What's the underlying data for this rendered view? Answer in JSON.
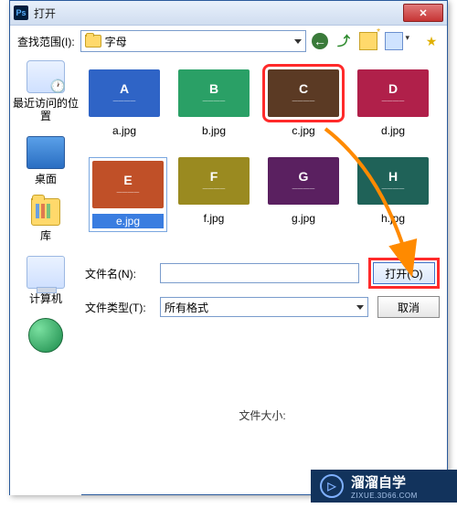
{
  "window": {
    "title": "打开"
  },
  "lookIn": {
    "label": "查找范围(I):",
    "folder": "字母"
  },
  "places": {
    "recent": "最近访问的位置",
    "desktop": "桌面",
    "library": "库",
    "computer": "计算机"
  },
  "files": {
    "row1": [
      {
        "letter": "A",
        "name": "a.jpg",
        "color": "#2f64c6"
      },
      {
        "letter": "B",
        "name": "b.jpg",
        "color": "#2aa066"
      },
      {
        "letter": "C",
        "name": "c.jpg",
        "color": "#5b3a24",
        "selected_red": true
      },
      {
        "letter": "D",
        "name": "d.jpg",
        "color": "#b0204a"
      }
    ],
    "row2": [
      {
        "letter": "E",
        "name": "e.jpg",
        "color": "#c05028",
        "selected_blue": true
      },
      {
        "letter": "F",
        "name": "f.jpg",
        "color": "#9a8a20"
      },
      {
        "letter": "G",
        "name": "g.jpg",
        "color": "#5a2060"
      },
      {
        "letter": "H",
        "name": "h.jpg",
        "color": "#1f6258"
      }
    ]
  },
  "fileName": {
    "label": "文件名(N):",
    "value": ""
  },
  "fileType": {
    "label": "文件类型(T):",
    "value": "所有格式"
  },
  "buttons": {
    "open": "打开(O)",
    "cancel": "取消"
  },
  "fileSizeLabel": "文件大小:",
  "brand": {
    "name": "溜溜自学",
    "sub": "ZIXUE.3D66.COM"
  }
}
